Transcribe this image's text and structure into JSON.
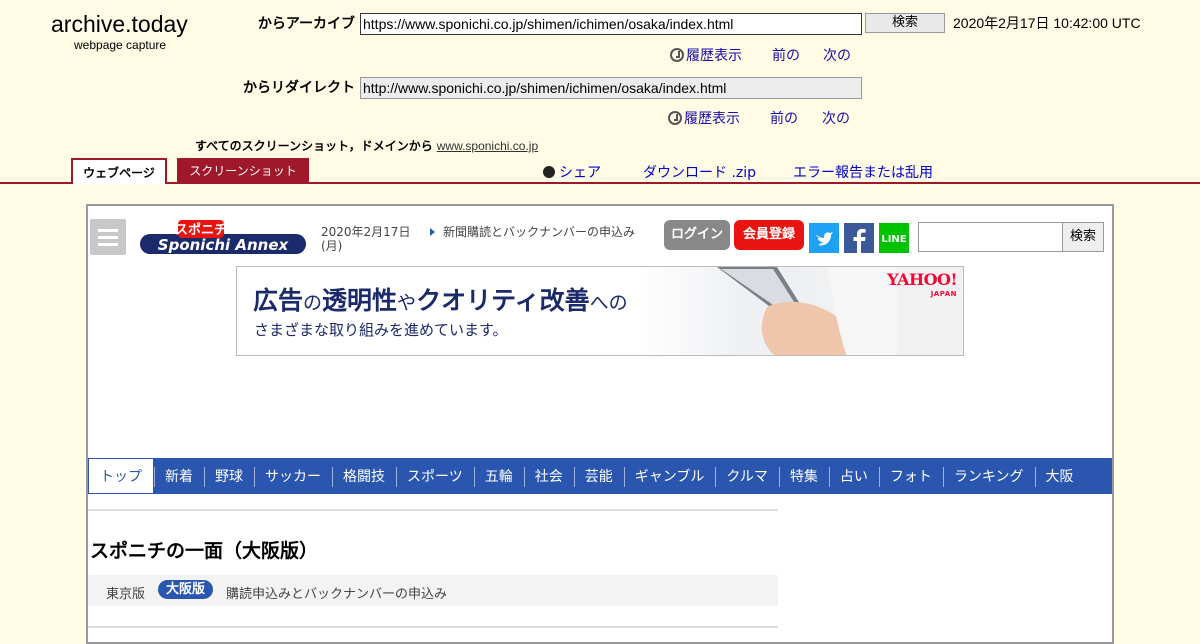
{
  "archive": {
    "brand": "archive.today",
    "brand_sub": "webpage capture",
    "from_label": "からアーカイブ",
    "from_url": "https://www.sponichi.co.jp/shimen/ichimen/osaka/index.html",
    "search_button": "検索",
    "timestamp": "2020年2月17日 10:42:00 UTC",
    "history": "履歴表示",
    "prev": "前の",
    "next": "次の",
    "redirect_label": "からリダイレクト",
    "redirect_url": "http://www.sponichi.co.jp/shimen/ichimen/osaka/index.html",
    "all_shots": "すべてのスクリーンショット，ドメインから",
    "domain": "www.sponichi.co.jp",
    "tab_webpage": "ウェブページ",
    "tab_screenshot": "スクリーンショット",
    "share": "シェア",
    "download": "ダウンロード .zip",
    "report": "エラー報告または乱用"
  },
  "page": {
    "date": "2020年2月17日(月)",
    "news_link": "新聞購読とバックナンバーの申込み",
    "login": "ログイン",
    "register": "会員登録",
    "social": [
      "twitter-icon",
      "facebook-icon",
      "line-icon"
    ],
    "line_text": "LINE",
    "search_button": "検索",
    "banner": {
      "w1": "広告",
      "p1": "の",
      "w2": "透明性",
      "p2": "や",
      "w3": "クオリティ改善",
      "p3": "への",
      "line2": "さまざまな取り組みを進めています。",
      "yahoo": "YAHOO!",
      "japan": "JAPAN"
    },
    "nav": [
      "トップ",
      "新着",
      "野球",
      "サッカー",
      "格闘技",
      "スポーツ",
      "五輪",
      "社会",
      "芸能",
      "ギャンブル",
      "クルマ",
      "特集",
      "占い",
      "フォト",
      "ランキング",
      "大阪"
    ],
    "title": "スポニチの一面（大阪版）",
    "edition_tokyo": "東京版",
    "edition_osaka": "大阪版",
    "edition_sub": "購読申込みとバックナンバーの申込み"
  },
  "colors": {
    "archive_bg": "#fffbe5",
    "archive_accent": "#a0192a",
    "site_blue": "#2a56b0",
    "register_red": "#e8140f"
  }
}
